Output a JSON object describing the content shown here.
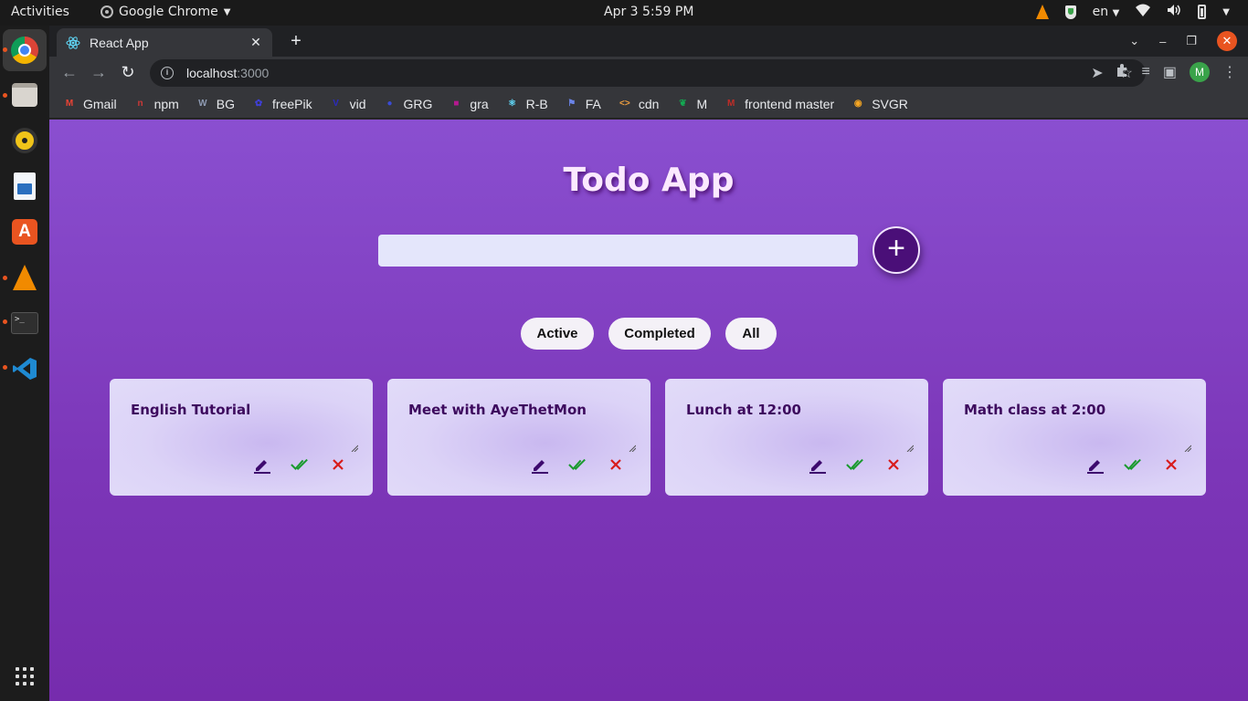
{
  "topbar": {
    "activities": "Activities",
    "app_name": "Google Chrome",
    "clock": "Apr 3   5:59 PM",
    "lang": "en"
  },
  "dock": {
    "items": [
      "chrome-icon",
      "files-icon",
      "rhythmbox-icon",
      "writer-icon",
      "software-store-icon",
      "vlc-icon",
      "terminal-icon",
      "vscode-icon"
    ]
  },
  "browser": {
    "tab_title": "React App",
    "url_host": "localhost",
    "url_port": ":3000",
    "avatar_letter": "M",
    "bookmarks": [
      {
        "label": "Gmail",
        "icon": "gmail-icon",
        "color": "#ea4335"
      },
      {
        "label": "npm",
        "icon": "npm-icon",
        "color": "#cb3837"
      },
      {
        "label": "BG",
        "icon": "bg-icon",
        "color": "#8f9bb3"
      },
      {
        "label": "freePik",
        "icon": "freepik-icon",
        "color": "#3f3fd8"
      },
      {
        "label": "vid",
        "icon": "vid-icon",
        "color": "#2b2bbf"
      },
      {
        "label": "GRG",
        "icon": "grg-icon",
        "color": "#3a4bd6"
      },
      {
        "label": "gra",
        "icon": "gra-icon",
        "color": "#b5198f"
      },
      {
        "label": "R-B",
        "icon": "react-bootstrap-icon",
        "color": "#61dafb"
      },
      {
        "label": "FA",
        "icon": "flag-icon",
        "color": "#6b84e8"
      },
      {
        "label": "cdn",
        "icon": "code-icon",
        "color": "#f0a040"
      },
      {
        "label": "M",
        "icon": "mongodb-leaf-icon",
        "color": "#13aa52"
      },
      {
        "label": "frontend master",
        "icon": "frontend-masters-icon",
        "color": "#c02d28"
      },
      {
        "label": "SVGR",
        "icon": "svgr-icon",
        "color": "#f5a623"
      }
    ]
  },
  "app": {
    "title": "Todo App",
    "input_value": "",
    "add_label": "+",
    "filters": [
      "Active",
      "Completed",
      "All"
    ],
    "todos": [
      {
        "text": "English Tutorial"
      },
      {
        "text": "Meet with AyeThetMon"
      },
      {
        "text": "Lunch at 12:00"
      },
      {
        "text": "Math class at 2:00"
      }
    ],
    "colors": {
      "edit": "#3d0a6e",
      "complete": "#1a9a2e",
      "delete": "#d81c1c",
      "add_button": "#4a0f78"
    }
  }
}
